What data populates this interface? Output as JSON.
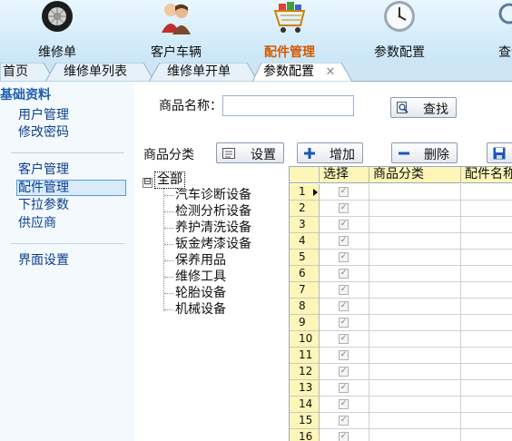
{
  "topnav": {
    "items": [
      {
        "label": "维修单",
        "icon": "tire-icon"
      },
      {
        "label": "客户车辆",
        "icon": "users-icon"
      },
      {
        "label": "配件管理",
        "icon": "parts-cart-icon",
        "active": true
      },
      {
        "label": "参数配置",
        "icon": "clock-icon"
      },
      {
        "label": "查询",
        "icon": "magnifier-icon"
      }
    ]
  },
  "tabs": {
    "items": [
      "首页",
      "维修单列表",
      "维修单开单",
      "参数配置"
    ],
    "close": "✕"
  },
  "sidebar": {
    "heading": "基础资料",
    "group1": [
      "用户管理",
      "修改密码"
    ],
    "group2": [
      "客户管理",
      "配件管理",
      "下拉参数",
      "供应商"
    ],
    "group3": [
      "界面设置"
    ],
    "selected": "配件管理"
  },
  "search": {
    "label": "商品名称：",
    "value": "",
    "button": "查找"
  },
  "category": {
    "label": "商品分类",
    "settings_button": "设置",
    "add_button": "增加",
    "delete_button": "删除"
  },
  "tree": {
    "root": "全部",
    "expander": "⊟",
    "nodes": [
      "汽车诊断设备",
      "检测分析设备",
      "养护清洗设备",
      "钣金烤漆设备",
      "保养用品",
      "维修工具",
      "轮胎设备",
      "机械设备"
    ]
  },
  "grid": {
    "columns": [
      "选择",
      "商品分类",
      "配件名称"
    ],
    "rows": [
      "1",
      "2",
      "3",
      "4",
      "5",
      "6",
      "7",
      "8",
      "9",
      "10",
      "11",
      "12",
      "13",
      "14",
      "15",
      "16"
    ],
    "check_mark": "✓"
  },
  "colors": {
    "accent": "#d25a00",
    "link": "#0c3f8f",
    "grid_header": "#fdf6b8",
    "sidebar_bg": "#f3f9fd"
  }
}
